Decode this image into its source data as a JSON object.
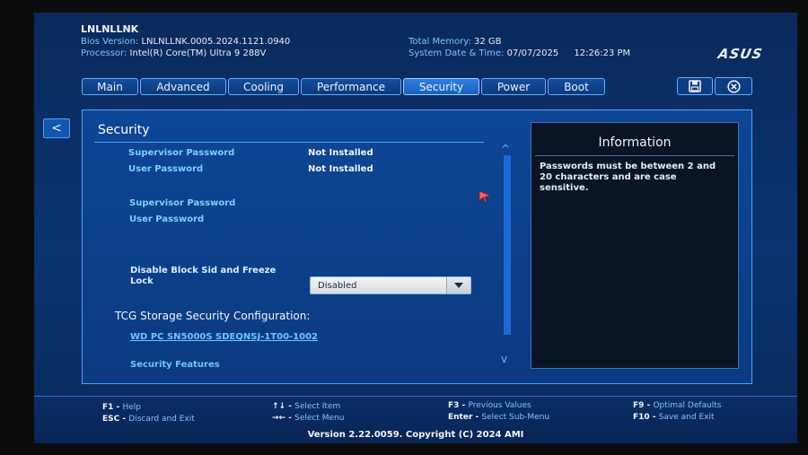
{
  "header": {
    "board": "LNLNLLNK",
    "bios_label": "Bios Version:",
    "bios_value": "LNLNLLNK.0005.2024.1121.0940",
    "processor_label": "Processor:",
    "processor_value": "Intel(R) Core(TM) Ultra 9 288V",
    "memory_label": "Total Memory:",
    "memory_value": "32 GB",
    "datetime_label": "System Date & Time:",
    "date_value": "07/07/2025",
    "time_value": "12:26:23 PM",
    "brand": "ASUS"
  },
  "tabs": [
    {
      "label": "Main",
      "active": false
    },
    {
      "label": "Advanced",
      "active": false
    },
    {
      "label": "Cooling",
      "active": false
    },
    {
      "label": "Performance",
      "active": false
    },
    {
      "label": "Security",
      "active": true
    },
    {
      "label": "Power",
      "active": false
    },
    {
      "label": "Boot",
      "active": false
    }
  ],
  "toolbar": {
    "save_icon": "save-icon",
    "exit_icon": "close-circle-icon"
  },
  "nav": {
    "back_label": "<"
  },
  "security": {
    "title": "Security",
    "supervisor_status_label": "Supervisor Password",
    "supervisor_status_value": "Not Installed",
    "user_status_label": "User Password",
    "user_status_value": "Not Installed",
    "supervisor_set_label": "Supervisor Password",
    "user_set_label": "User Password",
    "block_sid_label_1": "Disable Block Sid and Freeze",
    "block_sid_label_2": "Lock",
    "block_sid_value": "Disabled",
    "tcg_heading": "TCG Storage Security Configuration:",
    "drive_link": "WD PC SN5000S SDEQNSJ-1T00-1002",
    "security_features": "Security Features",
    "scroll_up": "^",
    "scroll_down": "v"
  },
  "info": {
    "title": "Information",
    "text": "Passwords must be between 2 and 20 characters and are case sensitive."
  },
  "footer": {
    "f1": "F1",
    "f1_desc": "Help",
    "esc": "ESC",
    "esc_desc": "Discard and Exit",
    "arrows_ud": "↑↓",
    "arrows_ud_desc": "Select Item",
    "arrows_lr": "→←",
    "arrows_lr_desc": "Select Menu",
    "f3": "F3",
    "f3_desc": "Previous Values",
    "enter": "Enter",
    "enter_desc": "Select Sub-Menu",
    "f9": "F9",
    "f9_desc": "Optimal Defaults",
    "f10": "F10",
    "f10_desc": "Save and Exit",
    "version": "Version 2.22.0059. Copyright (C) 2024 AMI"
  },
  "colors": {
    "accent": "#4aa3ff",
    "label": "#7fd0ff",
    "background": "#0b3470"
  }
}
